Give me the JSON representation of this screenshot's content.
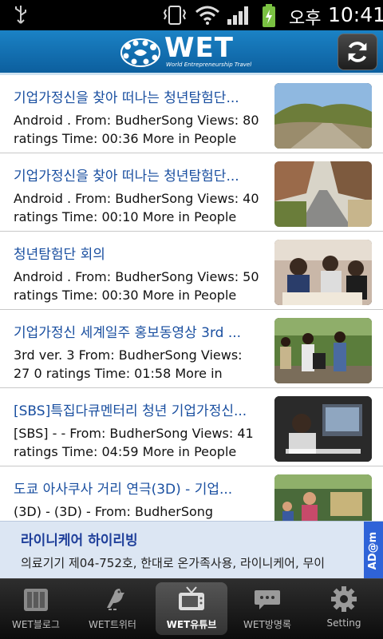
{
  "status": {
    "ampm": "오후",
    "time": "10:41"
  },
  "header": {
    "logo_text": "WET",
    "logo_tagline": "World Entrepreneurship Travel"
  },
  "videos": [
    {
      "title": "기업가정신을 찾아 떠나는 청년탐험단...",
      "desc": "Android . From: BudherSong Views: 80 ratings Time: 00:36 More in People",
      "thumb": "road-hill"
    },
    {
      "title": "기업가정신을 찾아 떠나는 청년탐험단...",
      "desc": "Android . From: BudherSong Views: 40 ratings Time: 00:10 More in People",
      "thumb": "road-village"
    },
    {
      "title": "청년탐험단 회의",
      "desc": "Android . From: BudherSong Views: 50 ratings Time: 00:30 More in People",
      "thumb": "meeting"
    },
    {
      "title": "기업가정신 세계일주 홍보동영상 3rd ...",
      "desc": "3rd ver. 3 From: BudherSong Views: 27 0 ratings Time: 01:58 More in",
      "thumb": "outdoor-people"
    },
    {
      "title": "[SBS]특집다큐멘터리 청년 기업가정신...",
      "desc": "[SBS] - - From: BudherSong Views: 41 ratings Time: 04:59 More in People",
      "thumb": "documentary"
    },
    {
      "title": "도쿄 아사쿠사 거리 연극(3D) - 기업...",
      "desc": "(3D) - (3D) - From: BudherSong",
      "thumb": "street"
    }
  ],
  "ad": {
    "title": "라이니케어 하이리빙",
    "text": "의료기기 제04-752호, 한대로 온가족사용, 라이니케어, 무이",
    "badge": "AD@m"
  },
  "tabs": [
    {
      "label": "WET블로그",
      "icon": "blog-icon"
    },
    {
      "label": "WET트위터",
      "icon": "bird-icon"
    },
    {
      "label": "WET유튜브",
      "icon": "tv-icon",
      "active": true
    },
    {
      "label": "WET방명록",
      "icon": "chat-bubble-icon"
    },
    {
      "label": "Setting",
      "icon": "gear-icon"
    }
  ],
  "colors": {
    "header": "#1b82c5",
    "title": "#1a4fa0",
    "ad_bg": "#dce6f3",
    "ad_badge": "#2f63d8"
  }
}
